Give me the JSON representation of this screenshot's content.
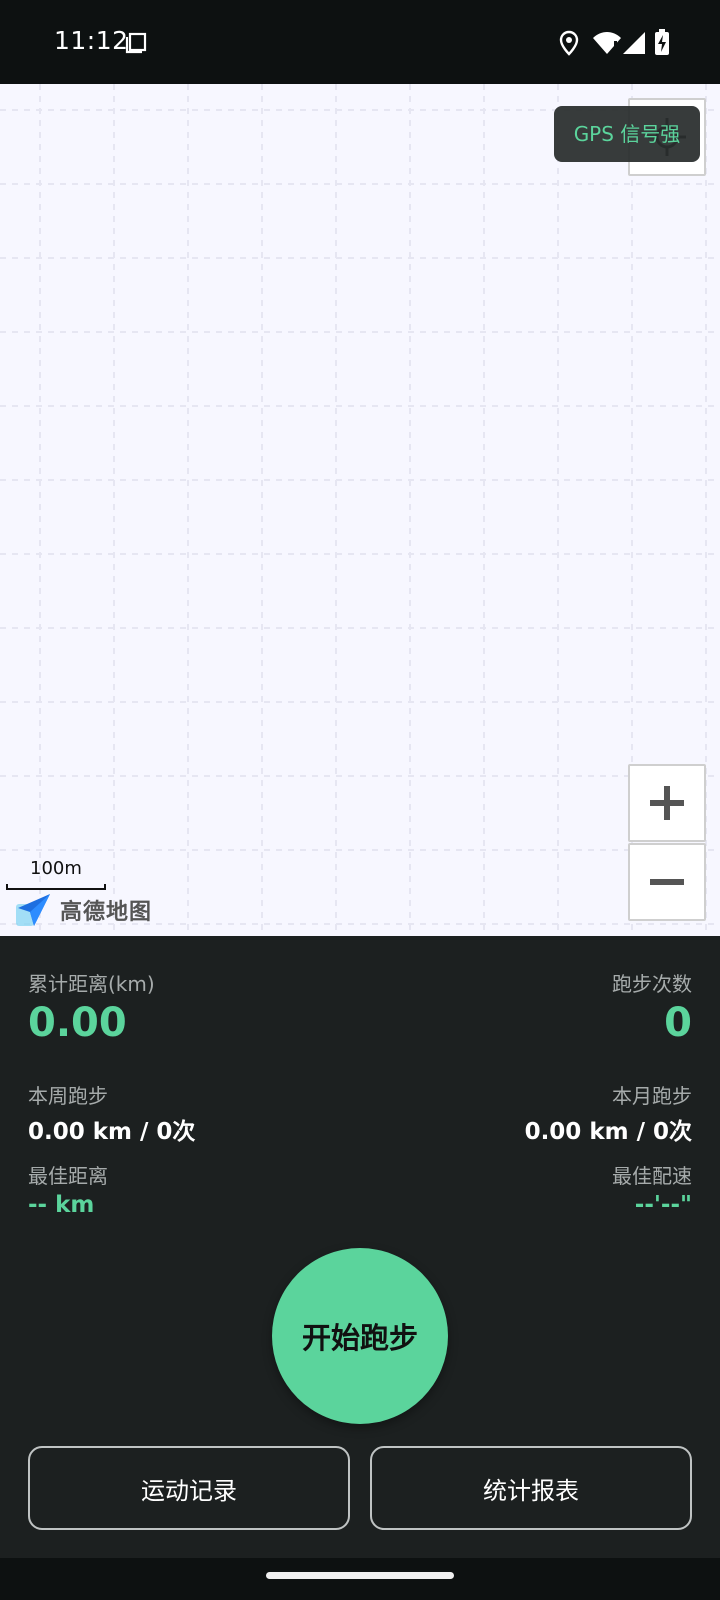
{
  "status_bar": {
    "time": "11:12",
    "icons": [
      "screenshot-icon",
      "location-icon",
      "wifi-icon",
      "signal-icon",
      "battery-charging-icon"
    ]
  },
  "map": {
    "gps_status": "GPS 信号强",
    "scale": "100m",
    "provider": "高德地图",
    "controls": [
      "locate-icon",
      "zoom-in-icon",
      "zoom-out-icon"
    ]
  },
  "stats": {
    "total_distance": {
      "label": "累计距离(km)",
      "value": "0.00"
    },
    "run_count": {
      "label": "跑步次数",
      "value": "0"
    },
    "week": {
      "label": "本周跑步",
      "value": "0.00 km / 0次"
    },
    "month": {
      "label": "本月跑步",
      "value": "0.00 km / 0次"
    },
    "best_distance": {
      "label": "最佳距离",
      "value": "-- km"
    },
    "best_pace": {
      "label": "最佳配速",
      "value": "--'--\""
    }
  },
  "actions": {
    "start": "开始跑步",
    "records": "运动记录",
    "report": "统计报表"
  },
  "colors": {
    "accent": "#5bd49c",
    "panel": "#1c2020",
    "map_bg": "#f7f7ff"
  }
}
